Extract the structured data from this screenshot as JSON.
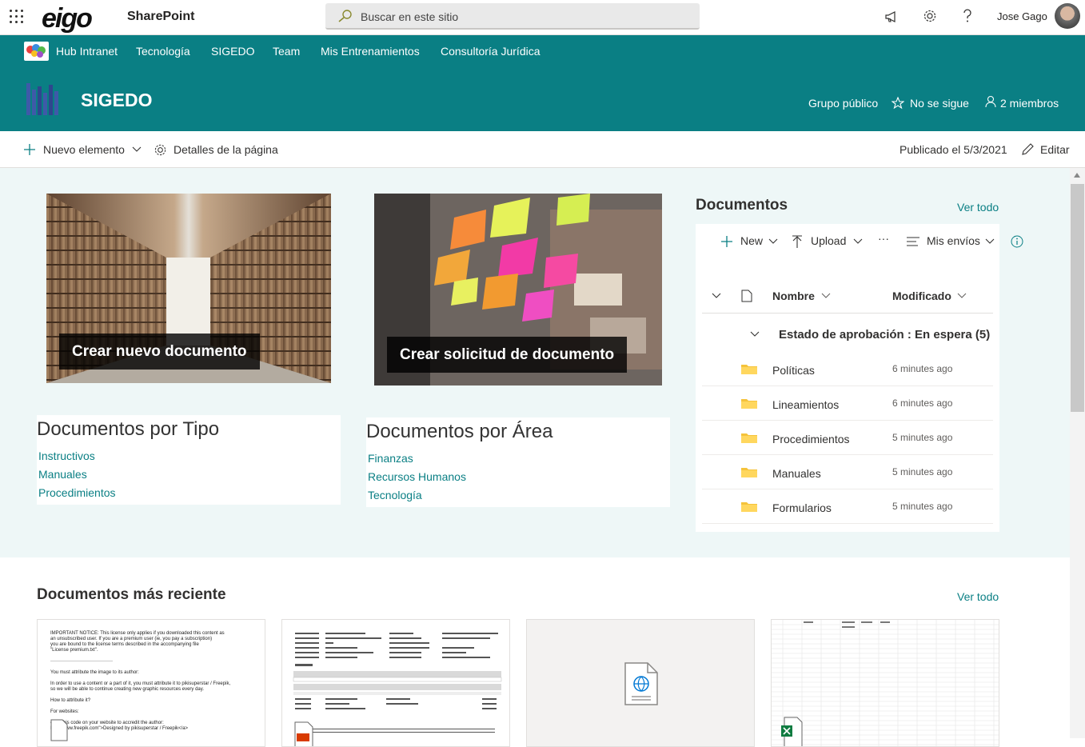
{
  "suite": {
    "app": "SharePoint",
    "logo": "eigo",
    "search_placeholder": "Buscar en este sitio",
    "user": "Jose Gago"
  },
  "hubnav": [
    "Hub Intranet",
    "Tecnología",
    "SIGEDO",
    "Team",
    "Mis Entrenamientos",
    "Consultoría Jurídica"
  ],
  "site": {
    "title": "SIGEDO",
    "privacy": "Grupo público",
    "follow": "No se sigue",
    "members": "2 miembros"
  },
  "commandbar": {
    "new": "Nuevo elemento",
    "details": "Detalles de la página",
    "published": "Publicado el 5/3/2021",
    "edit": "Editar"
  },
  "heroes": [
    {
      "label": "Crear nuevo documento"
    },
    {
      "label": "Crear solicitud de documento"
    }
  ],
  "quicklinks": [
    {
      "title": "Documentos por Tipo",
      "links": [
        "Instructivos",
        "Manuales",
        "Procedimientos"
      ]
    },
    {
      "title": "Documentos por Área",
      "links": [
        "Finanzas",
        "Recursos Humanos",
        "Tecnología"
      ]
    }
  ],
  "documents": {
    "title": "Documentos",
    "see_all": "Ver todo",
    "commands": {
      "new": "New",
      "upload": "Upload",
      "more": "···",
      "view": "Mis envíos"
    },
    "columns": {
      "name": "Nombre",
      "modified": "Modificado"
    },
    "group": "Estado de aprobación : En espera (5)",
    "rows": [
      {
        "name": "Políticas",
        "modified": "6 minutes ago"
      },
      {
        "name": "Lineamientos",
        "modified": "6 minutes ago"
      },
      {
        "name": "Procedimientos",
        "modified": "5 minutes ago"
      },
      {
        "name": "Manuales",
        "modified": "5 minutes ago"
      },
      {
        "name": "Formularios",
        "modified": "5 minutes ago"
      }
    ]
  },
  "recent": {
    "title": "Documentos más reciente",
    "see_all": "Ver todo",
    "card1_text": [
      "IMPORTANT NOTICE: This license only applies if you downloaded this content as",
      "an unsubscribed user. If you are a premium user (ie, you pay a subscription)",
      "you are bound to the license terms described in the accompanying file",
      "\"License premium.txt\".",
      "",
      "You must attribute the image to its author:",
      "",
      "In order to use a content or a part of it, you must attribute it to pikisuperstar / Freepik,",
      "so we will be able to continue creating new graphic resources every day.",
      "",
      "How to attribute it?",
      "",
      "For websites:",
      "",
      "copy this code on your website to accredit the author:",
      "http://www.freepik.com\">Designed by pikisuperstar / Freepik</a>"
    ]
  }
}
